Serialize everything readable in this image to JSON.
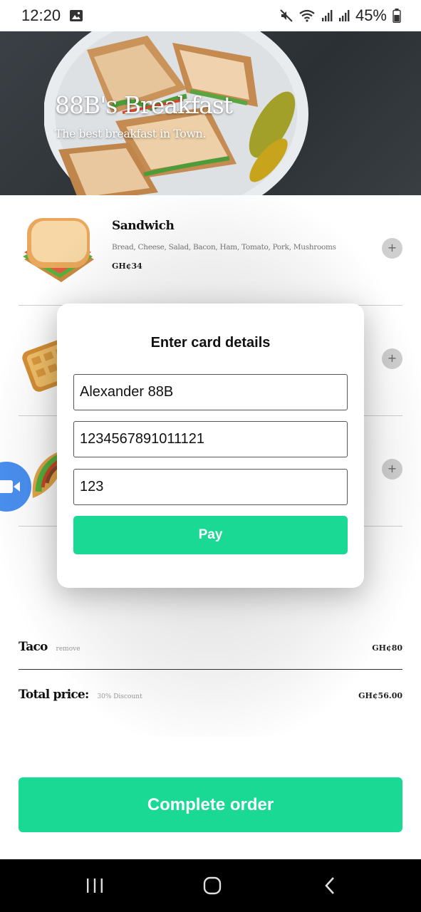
{
  "status_bar": {
    "time": "12:20",
    "battery": "45%",
    "icons": [
      "gallery-icon",
      "mute-icon",
      "wifi-icon",
      "signal-icon",
      "signal-icon",
      "battery-icon"
    ]
  },
  "hero": {
    "title": "88B's Breakfast",
    "subtitle": "The best breakfast in Town."
  },
  "menu": {
    "items": [
      {
        "name": "Sandwich",
        "description": "Bread, Cheese, Salad, Bacon, Ham, Tomato, Pork, Mushrooms",
        "price": "GH¢34",
        "add_label": "+",
        "emoji": "sandwich-icon"
      },
      {
        "name": "",
        "description": "",
        "price": "",
        "add_label": "+",
        "emoji": "waffle-icon"
      },
      {
        "name": "",
        "description": "",
        "price": "",
        "add_label": "+",
        "emoji": "taco-icon"
      }
    ]
  },
  "cart": {
    "item_name": "Taco",
    "item_remove": "remove",
    "item_price": "GH¢80",
    "total_label": "Total price:",
    "discount": "30% Discount",
    "total_value": "GH¢56.00"
  },
  "complete_button": "Complete order",
  "modal": {
    "title": "Enter card details",
    "name_value": "Alexander 88B",
    "card_number_value": "1234567891011121",
    "cvv_value": "123",
    "pay_label": "Pay"
  },
  "colors": {
    "accent": "#19d995",
    "video_bubble": "#4a8ff0"
  }
}
